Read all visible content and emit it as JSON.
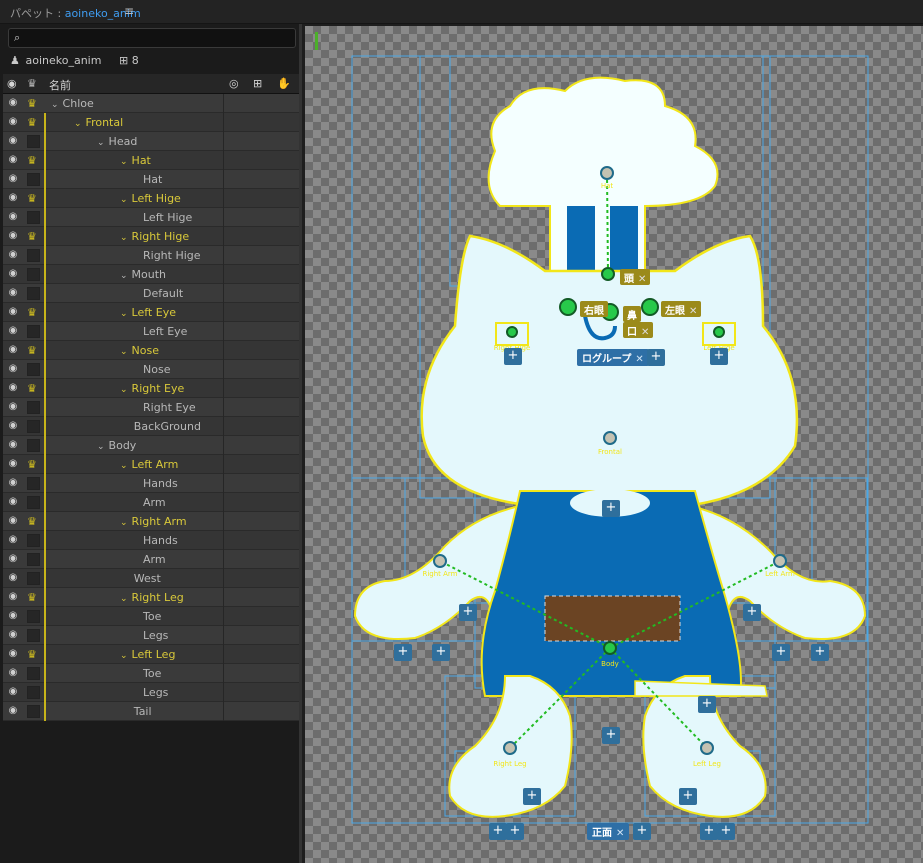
{
  "title": {
    "prefix": "パペット : ",
    "project": "aoineko_anim",
    "menu_icon": "≡"
  },
  "search": {
    "placeholder": "",
    "icon": "search-icon"
  },
  "doc": {
    "name": "aoineko_anim",
    "count": "8"
  },
  "columns": {
    "eye": "◉",
    "lock": "♛",
    "name": "名前",
    "c1": "◎",
    "c2": "⊞",
    "c3": "✋"
  },
  "rows": [
    {
      "name": "Chloe",
      "indent": 0,
      "type": "grp",
      "arrow": "⌄",
      "crown": true
    },
    {
      "name": "Frontal",
      "indent": 1,
      "type": "folder",
      "arrow": "⌄",
      "crown": true
    },
    {
      "name": "Head",
      "indent": 2,
      "type": "grp",
      "arrow": "⌄",
      "crown": false
    },
    {
      "name": "Hat",
      "indent": 3,
      "type": "folder",
      "arrow": "⌄",
      "crown": true
    },
    {
      "name": "Hat",
      "indent": 4,
      "type": "leaf",
      "arrow": "",
      "crown": false
    },
    {
      "name": "Left Hige",
      "indent": 3,
      "type": "folder",
      "arrow": "⌄",
      "crown": true
    },
    {
      "name": "Left Hige",
      "indent": 4,
      "type": "leaf",
      "arrow": "",
      "crown": false
    },
    {
      "name": "Right Hige",
      "indent": 3,
      "type": "folder",
      "arrow": "⌄",
      "crown": true
    },
    {
      "name": "Right Hige",
      "indent": 4,
      "type": "leaf",
      "arrow": "",
      "crown": false
    },
    {
      "name": "Mouth",
      "indent": 3,
      "type": "grp",
      "arrow": "⌄",
      "crown": false
    },
    {
      "name": "Default",
      "indent": 4,
      "type": "leaf",
      "arrow": "",
      "crown": false
    },
    {
      "name": "Left Eye",
      "indent": 3,
      "type": "folder",
      "arrow": "⌄",
      "crown": true
    },
    {
      "name": "Left Eye",
      "indent": 4,
      "type": "leaf",
      "arrow": "",
      "crown": false
    },
    {
      "name": "Nose",
      "indent": 3,
      "type": "folder",
      "arrow": "⌄",
      "crown": true
    },
    {
      "name": "Nose",
      "indent": 4,
      "type": "leaf",
      "arrow": "",
      "crown": false
    },
    {
      "name": "Right Eye",
      "indent": 3,
      "type": "folder",
      "arrow": "⌄",
      "crown": true
    },
    {
      "name": "Right Eye",
      "indent": 4,
      "type": "leaf",
      "arrow": "",
      "crown": false
    },
    {
      "name": "BackGround",
      "indent": 3.6,
      "type": "leaf",
      "arrow": "",
      "crown": false
    },
    {
      "name": "Body",
      "indent": 2,
      "type": "grp",
      "arrow": "⌄",
      "crown": false
    },
    {
      "name": "Left Arm",
      "indent": 3,
      "type": "folder",
      "arrow": "⌄",
      "crown": true
    },
    {
      "name": "Hands",
      "indent": 4,
      "type": "leaf",
      "arrow": "",
      "crown": false
    },
    {
      "name": "Arm",
      "indent": 4,
      "type": "leaf",
      "arrow": "",
      "crown": false
    },
    {
      "name": "Right Arm",
      "indent": 3,
      "type": "folder",
      "arrow": "⌄",
      "crown": true
    },
    {
      "name": "Hands",
      "indent": 4,
      "type": "leaf",
      "arrow": "",
      "crown": false
    },
    {
      "name": "Arm",
      "indent": 4,
      "type": "leaf",
      "arrow": "",
      "crown": false
    },
    {
      "name": "West",
      "indent": 3.6,
      "type": "leaf",
      "arrow": "",
      "crown": false
    },
    {
      "name": "Right Leg",
      "indent": 3,
      "type": "folder",
      "arrow": "⌄",
      "crown": true
    },
    {
      "name": "Toe",
      "indent": 4,
      "type": "leaf",
      "arrow": "",
      "crown": false
    },
    {
      "name": "Legs",
      "indent": 4,
      "type": "leaf",
      "arrow": "",
      "crown": false
    },
    {
      "name": "Left Leg",
      "indent": 3,
      "type": "folder",
      "arrow": "⌄",
      "crown": true
    },
    {
      "name": "Toe",
      "indent": 4,
      "type": "leaf",
      "arrow": "",
      "crown": false
    },
    {
      "name": "Legs",
      "indent": 4,
      "type": "leaf",
      "arrow": "",
      "crown": false
    },
    {
      "name": "Tail",
      "indent": 3.6,
      "type": "leaf",
      "arrow": "",
      "crown": false
    }
  ],
  "canvas": {
    "tags": {
      "head": "頭",
      "right_eye": "右眼",
      "nose": "鼻",
      "left_eye": "左眼",
      "mouth": "口",
      "mouth_group": "ログループ",
      "front": "正面",
      "close": "✕",
      "plus": "+"
    },
    "handles": {
      "hat": "Hat",
      "head": "Head",
      "right_eye": "Right Eye",
      "left_eye": "Left Eye",
      "nose": "Nose",
      "mouth": "Mouth",
      "right_hige": "Right Hige",
      "left_hige": "Left Hige",
      "frontal": "Frontal",
      "right_arm": "Right Arm",
      "left_arm": "Left Arm",
      "body": "Body",
      "right_leg": "Right Leg",
      "left_leg": "Left Leg"
    },
    "colors": {
      "outline": "#f2e619",
      "bound": "#4aa8e6",
      "body_fill": "#e4f8fc",
      "apron": "#0a6bb4",
      "pocket": "#6b4423",
      "dots": "#22bb22"
    }
  }
}
